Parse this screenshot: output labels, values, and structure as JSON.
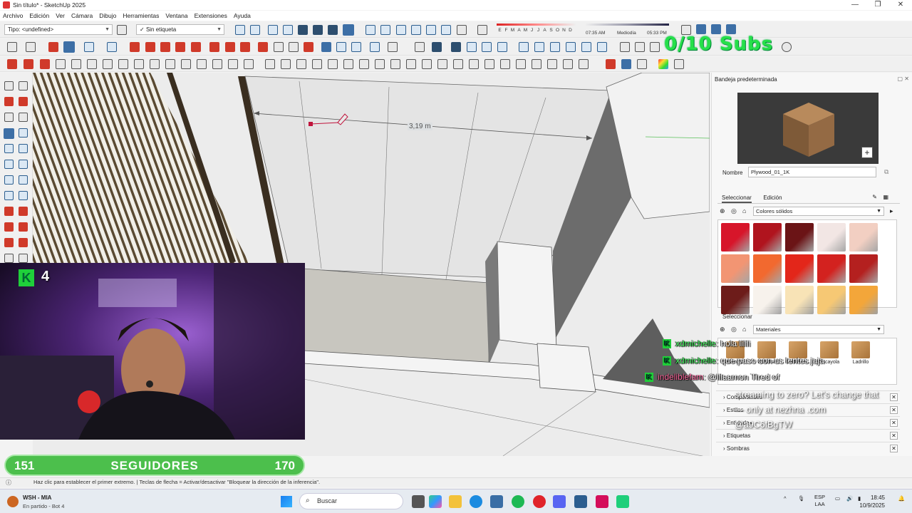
{
  "window": {
    "title": "Sin título* - SketchUp 2025",
    "min": "—",
    "max": "❐",
    "close": "✕"
  },
  "menu": [
    "Archivo",
    "Edición",
    "Ver",
    "Cámara",
    "Dibujo",
    "Herramientas",
    "Ventana",
    "Extensiones",
    "Ayuda"
  ],
  "toolbar": {
    "type_combo": "Tipo: <undefined>",
    "tag_combo": "Sin etiqueta",
    "months": [
      "E",
      "F",
      "M",
      "A",
      "M",
      "J",
      "J",
      "A",
      "S",
      "O",
      "N",
      "D"
    ],
    "time_start": "07:35 AM",
    "time_mid": "Mediodía",
    "time_end": "05:33 PM"
  },
  "overlay_subs": "0/10 Subs",
  "viewport": {
    "dimension": "3,19 m"
  },
  "webcam": {
    "k_count": "4"
  },
  "followers": {
    "left": "151",
    "label": "SEGUIDORES",
    "right": "170"
  },
  "statusbar": "Haz clic para establecer el primer extremo.  |  Teclas de flecha = Activar/desactivar \"Bloquear la dirección de la inferencia\".",
  "panel": {
    "title": "Bandeja predeterminada",
    "name_label": "Nombre",
    "name_value": "Plywood_01_1K",
    "tab_select": "Seleccionar",
    "tab_edit": "Edición",
    "collection": "Colores sólidos",
    "section2": "Seleccionar",
    "materials_collection": "Materiales",
    "materials": [
      "Asfalto &...",
      "Baldosa",
      "Colores s...",
      "Escayola",
      "Ladrillo"
    ],
    "swatch_colors": [
      "#d7152a",
      "#b0141e",
      "#6b1416",
      "#f2e6e4",
      "#f2cfc2",
      "#f29573",
      "#f2692f",
      "#e3261a",
      "#d3221f",
      "#b4201f",
      "#6d1c1a",
      "#f7f2ec",
      "#f8e3b6",
      "#f6c874",
      "#f3a63a"
    ],
    "trays": [
      "Componentes",
      "Estilos",
      "Entidades",
      "Etiquetas",
      "Sombras"
    ]
  },
  "chat": [
    {
      "user": "xdmichelle",
      "msg": "hola lilili"
    },
    {
      "user": "xdmichelle",
      "msg": "que paso con us lentes jaja"
    },
    {
      "user": "indeliblefam",
      "msg": "@lilaamon Tired of"
    }
  ],
  "promo": "streaming to zero? Let's change that — only at nezhna .com @a9C6fBgTW",
  "taskbar": {
    "app_name": "WSH - MIA",
    "app_sub": "En partido - Bot 4",
    "search": "Buscar",
    "lang_top": "ESP",
    "lang_bottom": "LAA",
    "time": "18:45",
    "date": "10/9/2025"
  }
}
